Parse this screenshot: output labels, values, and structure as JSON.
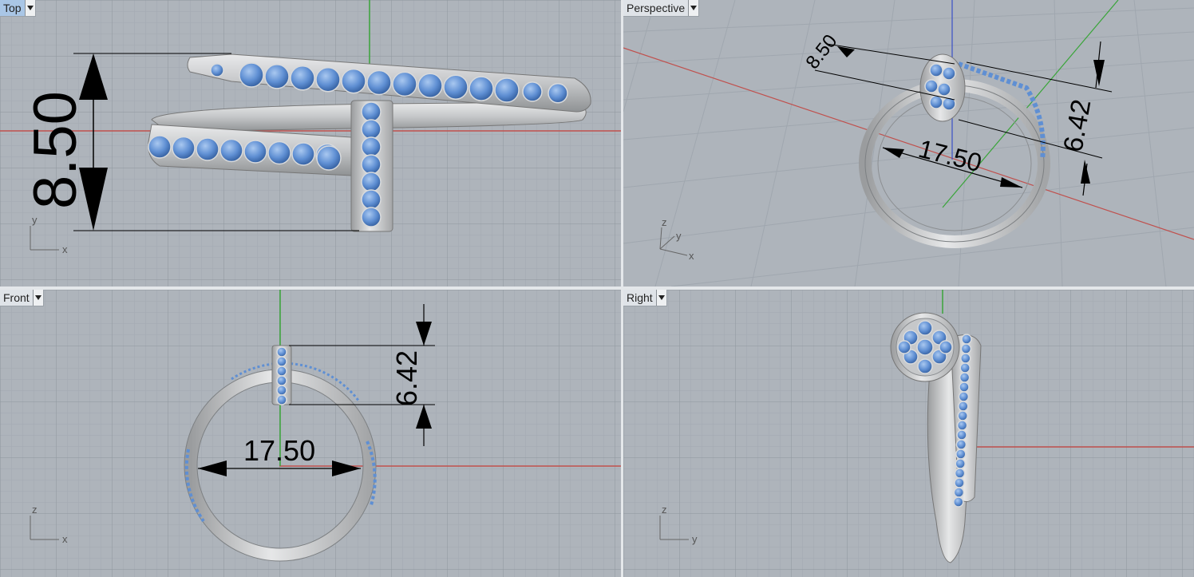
{
  "viewports": {
    "top": {
      "name": "Top",
      "dimension": "8.50",
      "axes": {
        "vertical": "y",
        "horizontal": "x"
      }
    },
    "perspective": {
      "name": "Perspective",
      "dimensions": {
        "head": "8.50",
        "diameter": "17.50",
        "height": "6.42"
      },
      "axes": {
        "up": "z",
        "depth": "y",
        "horizontal": "x"
      }
    },
    "front": {
      "name": "Front",
      "dimensions": {
        "height": "6.42",
        "diameter": "17.50"
      },
      "axes": {
        "vertical": "z",
        "horizontal": "x"
      }
    },
    "right": {
      "name": "Right",
      "axes": {
        "vertical": "z",
        "horizontal": "y"
      }
    }
  },
  "colors": {
    "viewport_bg": "#aeb4bb",
    "grid_minor": "#9fa6ae",
    "grid_major": "#8b939b",
    "axis_x": "#c0504d",
    "axis_y": "#3aa53a",
    "axis_z": "#3b4fc6",
    "metal": "#c9cbcd",
    "gem": "#5f8fd3",
    "active_label": "#a9c6e6"
  }
}
